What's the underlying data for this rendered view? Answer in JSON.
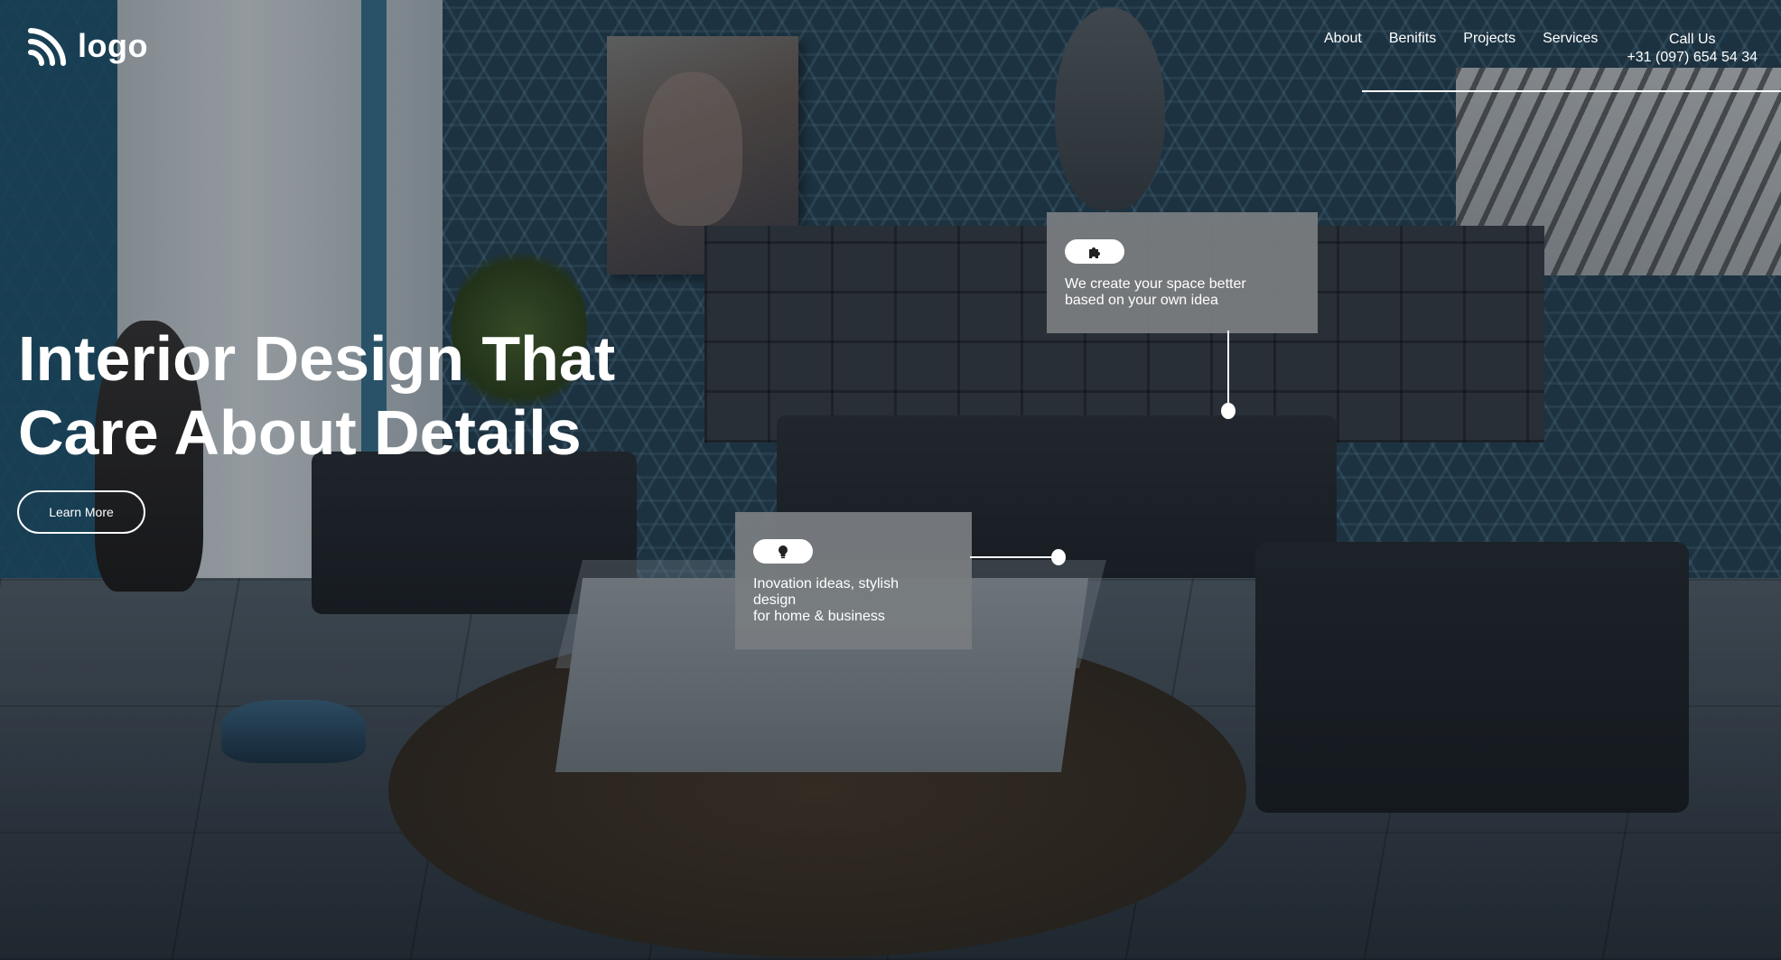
{
  "brand": {
    "logo_text": "logo",
    "icon": "wifi-arcs-logo-icon"
  },
  "nav": {
    "items": [
      {
        "label": "About"
      },
      {
        "label": "Benifits"
      },
      {
        "label": "Projects"
      },
      {
        "label": "Services"
      }
    ],
    "call_label": "Call Us",
    "phone": "+31 (097) 654 54 34"
  },
  "hero": {
    "title_line1": "Interior Design That",
    "title_line2": "Care About Details",
    "cta_label": "Learn More"
  },
  "cards": [
    {
      "icon": "puzzle-icon",
      "lines": [
        "We create your space better",
        "based on your own idea"
      ]
    },
    {
      "icon": "lightbulb-icon",
      "lines": [
        "Inovation ideas, stylish",
        "design",
        "for home & business"
      ]
    }
  ],
  "colors": {
    "card_bg": "#787c80",
    "text": "#ffffff",
    "wall": "#274556"
  }
}
